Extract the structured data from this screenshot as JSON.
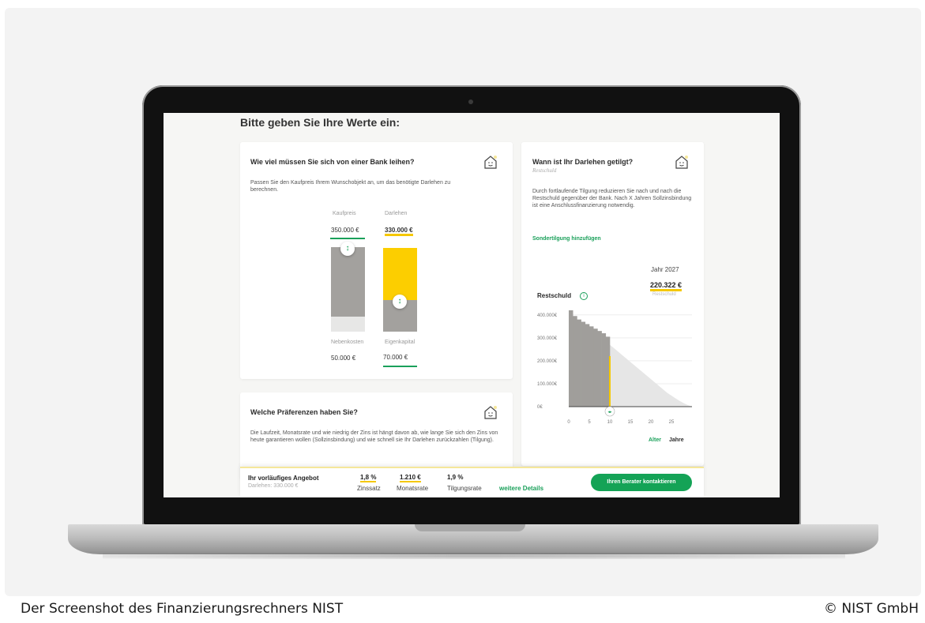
{
  "caption": {
    "left": "Der Screenshot des Finanzierungsrechners NIST",
    "right": "© NIST GmbH"
  },
  "page": {
    "title": "Bitte geben Sie Ihre Werte ein:"
  },
  "loan_card": {
    "title": "Wie viel müssen Sie sich von einer Bank leihen?",
    "text": "Passen Sie den Kaufpreis Ihrem Wunschobjekt an, um das benötigte Darlehen zu berechnen.",
    "kaufpreis_label": "Kaufpreis",
    "kaufpreis_value": "350.000 €",
    "darlehen_label": "Darlehen",
    "darlehen_value": "330.000 €",
    "nebenkosten_label": "Nebenkosten",
    "nebenkosten_value": "50.000 €",
    "eigenkapital_label": "Eigenkapital",
    "eigenkapital_value": "70.000 €"
  },
  "preferences_card": {
    "title": "Welche Präferenzen haben Sie?",
    "text": "Die Laufzeit, Monatsrate und wie niedrig der Zins ist hängt davon ab, wie lange Sie sich den Zins von heute garantieren wollen (Sollzinsbindung) und wie schnell sie Ihr Darlehen zurückzahlen (Tilgung)."
  },
  "repayment_card": {
    "title": "Wann ist Ihr Darlehen getilgt?",
    "subtitle": "Restschuld",
    "text": "Durch fortlaufende Tilgung reduzieren Sie nach und nach die Restschuld gegenüber der Bank. Nach X Jahren Sollzinsbindung ist eine Anschlussfinanzierung notwendig.",
    "link": "Sondertilgung hinzufügen",
    "year_label": "Jahr 2027",
    "year_value": "220.322 €",
    "year_sub": "Restschuld",
    "chart_label": "Restschuld",
    "info_icon_glyph": "i",
    "axis_alter": "Alter",
    "axis_jahre": "Jahre",
    "slider_glyph": "◂▸"
  },
  "offer": {
    "title": "Ihr vorläufiges Angebot",
    "subtitle": "Darlehen: 330.000 €",
    "zins_value": "1,8 %",
    "zins_label": "Zinssatz",
    "rate_value": "1.210 €",
    "rate_label": "Monatsrate",
    "tilgung_value": "1,9 %",
    "tilgung_label": "Tilgungsrate",
    "details_link": "weitere Details",
    "cta_label": "Ihren Berater kontaktieren"
  },
  "chart_data": {
    "type": "area",
    "title": "",
    "xlabel": "Jahre",
    "ylabel": "",
    "y_tick_labels": [
      "400.000€",
      "300.000€",
      "200.000€",
      "100.000€",
      "0€"
    ],
    "x_tick_labels": [
      "0",
      "5",
      "10",
      "15",
      "20",
      "25"
    ],
    "ylim": [
      0,
      420000
    ],
    "xlim": [
      0,
      30
    ],
    "marker_x": 10,
    "marker_value": 220322,
    "series": [
      {
        "x": [
          0,
          1,
          2,
          3,
          4,
          5,
          6,
          7,
          8,
          9,
          10,
          11,
          12,
          13,
          14,
          15,
          16,
          17,
          18,
          19,
          20,
          21,
          22,
          23,
          24,
          25,
          26,
          27,
          28,
          29,
          30
        ],
        "values": [
          420000,
          395000,
          380000,
          370000,
          360000,
          350000,
          340000,
          330000,
          320000,
          305000,
          270000,
          255000,
          240000,
          225000,
          210000,
          195000,
          180000,
          165000,
          150000,
          135000,
          120000,
          105000,
          90000,
          75000,
          60000,
          48000,
          36000,
          25000,
          15000,
          7000,
          0
        ]
      }
    ],
    "colors": {
      "paid_area": "#a09e9b",
      "remaining_area": "#e6e6e6",
      "marker": "#f5c800"
    },
    "grid": true
  },
  "colors": {
    "accent_green": "#1aa05a",
    "accent_yellow": "#f5c800",
    "bar_grey": "#a3a19e"
  }
}
